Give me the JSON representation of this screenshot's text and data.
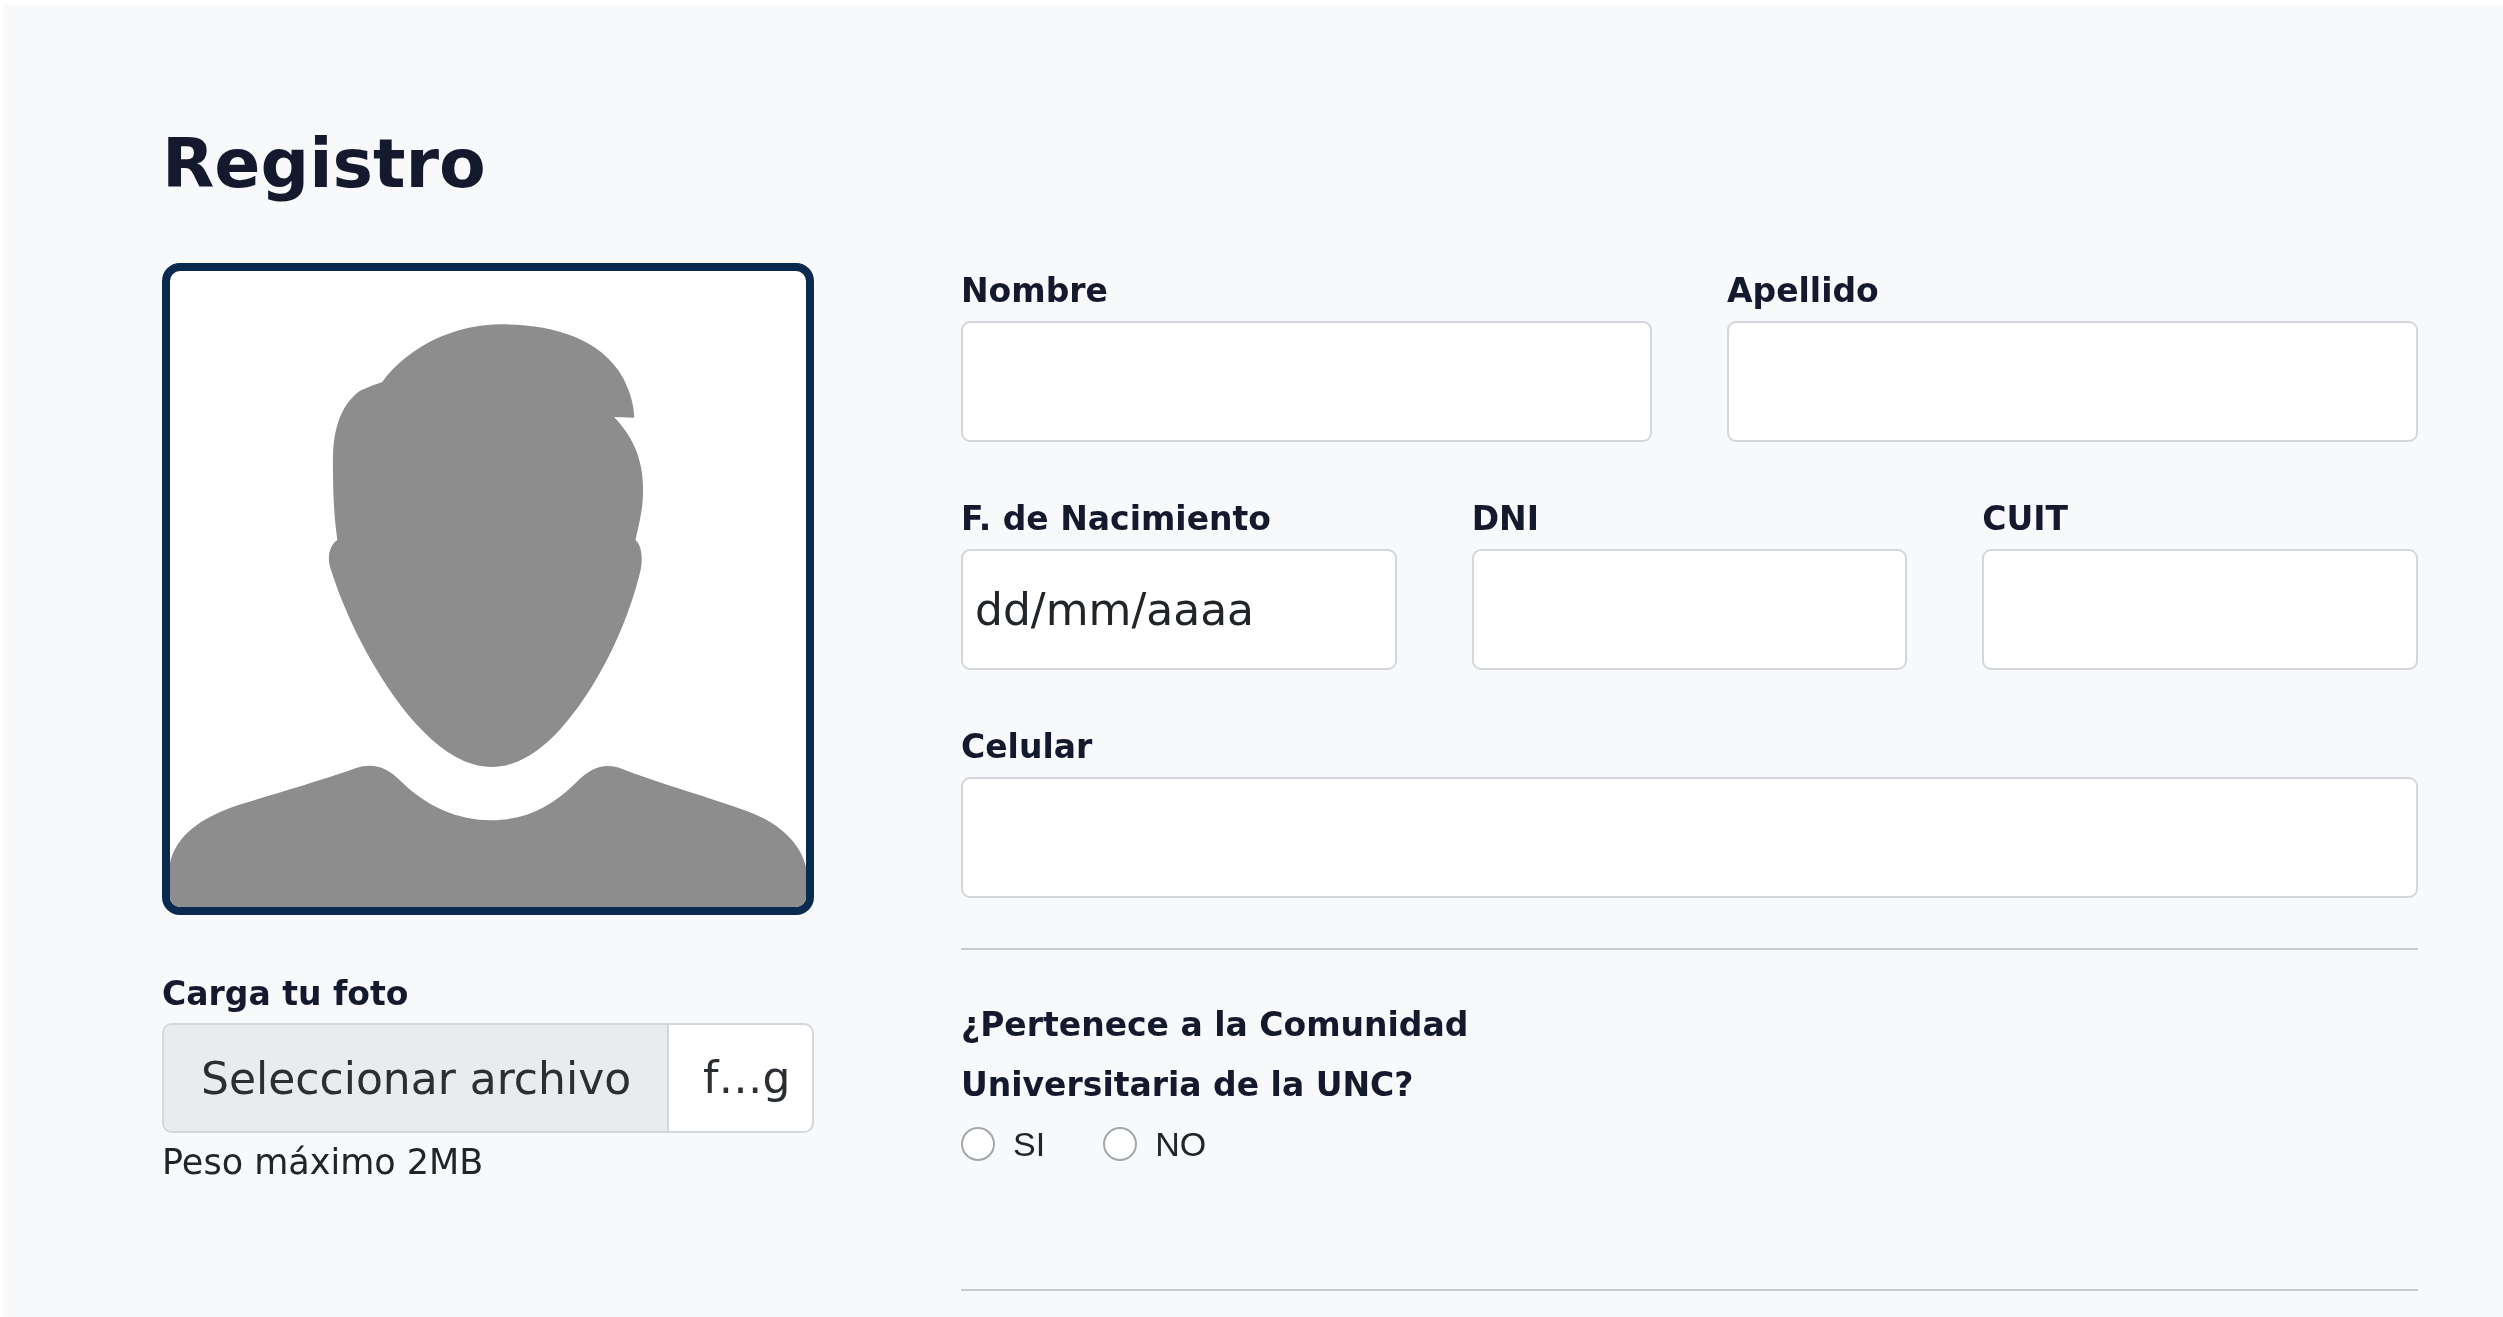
{
  "title": "Registro",
  "photo": {
    "label": "Carga tu foto",
    "button": "Seleccionar archivo",
    "file_name": "f…g",
    "hint": "Peso máximo 2MB"
  },
  "form": {
    "rows": [
      {
        "fields": [
          {
            "label": "Nombre"
          },
          {
            "label": "Apellido"
          }
        ]
      },
      {
        "fields": [
          {
            "label": "F. de Nacimiento",
            "placeholder": "dd/mm/aaaa"
          },
          {
            "label": "DNI"
          },
          {
            "label": "CUIT"
          }
        ]
      },
      {
        "fields": [
          {
            "label": "Celular"
          }
        ]
      }
    ]
  },
  "question": {
    "text": "¿Pertenece a la Comunidad Universitaria de la UNC?",
    "options": [
      {
        "label": "SI",
        "selected": false
      },
      {
        "label": "NO",
        "selected": false
      }
    ]
  }
}
